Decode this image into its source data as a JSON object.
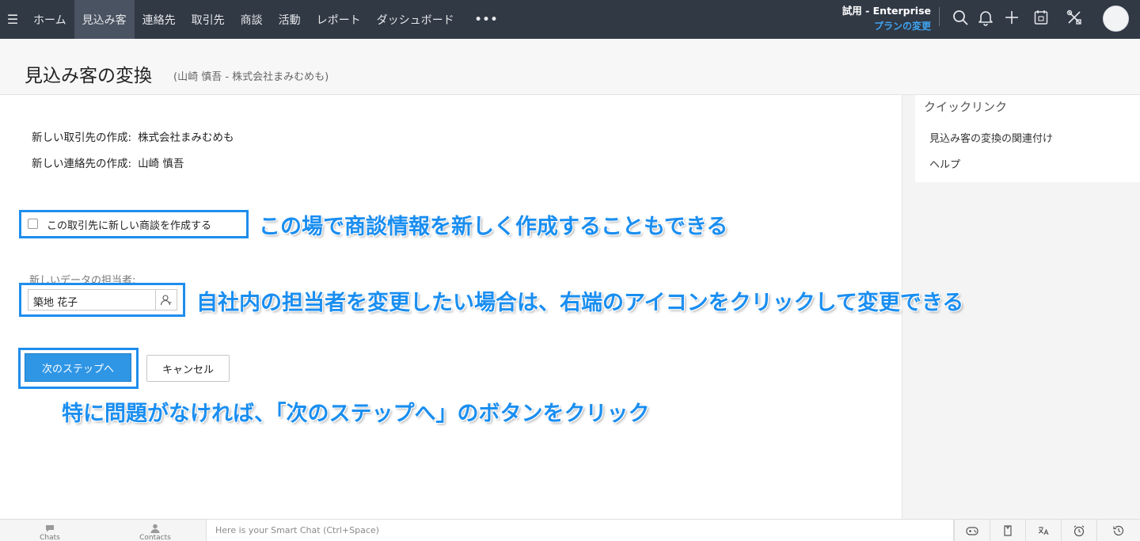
{
  "nav": {
    "menu_icon": "hamburger-icon",
    "items": [
      {
        "label": "ホーム"
      },
      {
        "label": "見込み客"
      },
      {
        "label": "連絡先"
      },
      {
        "label": "取引先"
      },
      {
        "label": "商談"
      },
      {
        "label": "活動"
      },
      {
        "label": "レポート"
      },
      {
        "label": "ダッシュボード"
      }
    ],
    "more": "•••",
    "active_index": 1
  },
  "trial": {
    "title": "試用 - Enterprise",
    "link": "プランの変更"
  },
  "toolbar_icons": [
    "search-icon",
    "bell-icon",
    "plus-icon",
    "calendar-icon",
    "tools-icon",
    "avatar"
  ],
  "header": {
    "title": "見込み客の変換",
    "subtitle": "(山崎 慎吾 - 株式会社まみむめも)"
  },
  "quick_links": {
    "title": "クイックリンク",
    "items": [
      {
        "label": "見込み客の変換の関連付け"
      },
      {
        "label": "ヘルプ"
      }
    ]
  },
  "info": {
    "account_label": "新しい取引先の作成:",
    "account_value": "株式会社まみむめも",
    "contact_label": "新しい連絡先の作成:",
    "contact_value": "山崎 慎吾"
  },
  "deal_checkbox": {
    "label": "この取引先に新しい商談を作成する",
    "checked": false
  },
  "owner": {
    "label": "新しいデータの担当者:",
    "value": "築地 花子"
  },
  "buttons": {
    "next": "次のステップへ",
    "cancel": "キャンセル"
  },
  "annotations": {
    "deal": "この場で商談情報を新しく作成することもできる",
    "owner": "自社内の担当者を変更したい場合は、右端のアイコンをクリックして変更できる",
    "next": "特に問題がなければ、「次のステップへ」のボタンをクリック"
  },
  "bottom": {
    "chats": "Chats",
    "contacts": "Contacts",
    "smart_chat_placeholder": "Here is your Smart Chat (Ctrl+Space)",
    "icons": [
      "gamepad-icon",
      "contact-card-icon",
      "translate-icon",
      "alarm-icon",
      "history-icon"
    ]
  },
  "colors": {
    "topbar": "#313945",
    "accent": "#1f8ded",
    "primary_button": "#2f96e6",
    "link": "#3fa4f0"
  }
}
